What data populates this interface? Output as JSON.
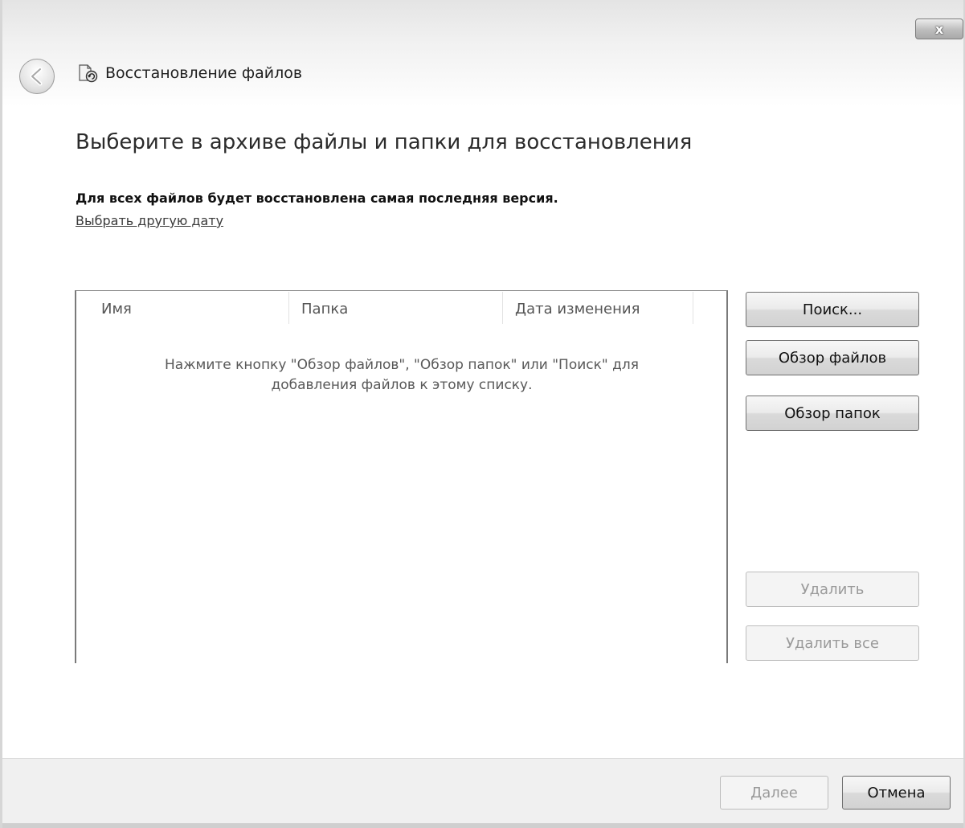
{
  "window": {
    "title": "Восстановление файлов",
    "close_glyph": "x"
  },
  "page": {
    "heading": "Выберите в архиве файлы и папки для восстановления",
    "info_text": "Для всех файлов будет восстановлена самая последняя версия.",
    "choose_date_link": "Выбрать другую дату"
  },
  "file_list": {
    "columns": [
      "Имя",
      "Папка",
      "Дата изменения"
    ],
    "empty_hint_line1": "Нажмите кнопку \"Обзор файлов\", \"Обзор папок\" или \"Поиск\" для",
    "empty_hint_line2": "добавления файлов к этому списку."
  },
  "side_buttons": {
    "search": "Поиск...",
    "browse_files": "Обзор файлов",
    "browse_folders": "Обзор папок",
    "remove": "Удалить",
    "remove_all": "Удалить все"
  },
  "footer": {
    "next": "Далее",
    "cancel": "Отмена"
  },
  "icons": {
    "back": "back-arrow-icon",
    "app": "file-restore-icon",
    "close": "close-icon"
  },
  "colors": {
    "heading": "#2b2b2b",
    "link": "#3a3a3a",
    "footer_bg": "#f0f0f0",
    "disabled_text": "#9a9a9a"
  }
}
